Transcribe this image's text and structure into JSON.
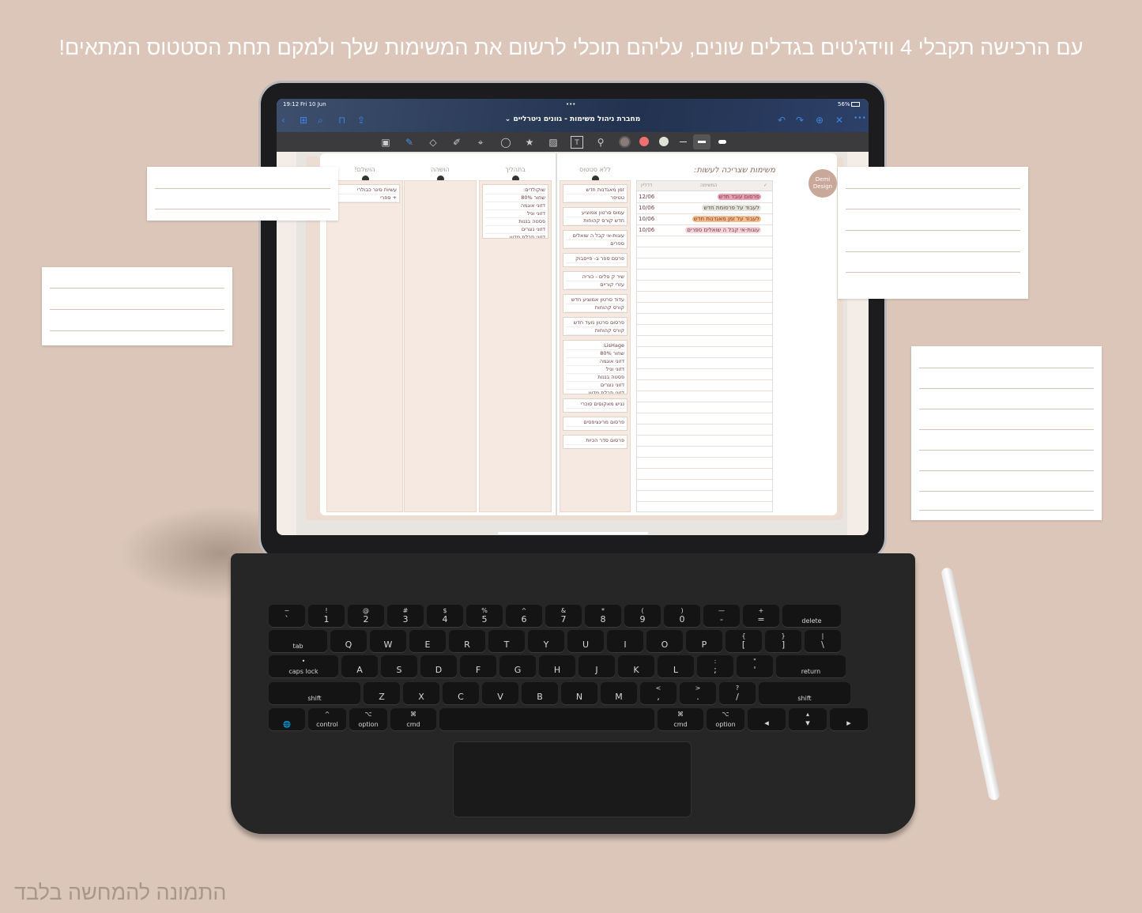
{
  "headline": "עם הרכישה תקבלי 4 ווידג'טים בגדלים שונים, עליהם תוכלי לרשום את המשימות שלך ולמקם תחת הסטטוס המתאים!",
  "disclaimer": "התמונה להמחשה בלבד",
  "status_bar": {
    "time": "19:12",
    "date": "Fri 10 Jun",
    "battery": "56%",
    "dots": "•••"
  },
  "app": {
    "title": "מחברת ניהול משימות - גוונים ניטרליים",
    "title_chevron": "⌄",
    "nav_left": [
      "‹",
      "⊞",
      "⌕",
      "⊓",
      "⇪"
    ],
    "nav_right": [
      "↶",
      "↷",
      "⊕",
      "✕",
      "•••"
    ],
    "tools": [
      "▣",
      "✎",
      "◇",
      "✐",
      "⌖",
      "◯",
      "★",
      "▨",
      "T",
      "⚲"
    ],
    "colors": [
      "#8a7a78",
      "#f07070",
      "#dfe3d6"
    ]
  },
  "planner": {
    "title": "משימות שצריכה לעשות:",
    "logo": "Demi Design",
    "columns": [
      {
        "header": "הושלם!",
        "cards": [
          [
            "עשיות סיגר כבולרי",
            "+ ספרי"
          ]
        ]
      },
      {
        "header": "הושהה",
        "cards": []
      },
      {
        "header": "בתהליך",
        "cards": [
          [
            "שוקולדים:",
            "שחור 80%",
            "דזוני אוגמה",
            "דזוני וניל",
            "פסטה בננות",
            "דזוני נוגרים",
            "דזוני תבלת מדוע"
          ]
        ]
      },
      {
        "header": "ללא סטטוס",
        "cards": [
          [
            "זמן מאגדנות חדש",
            "טטיפר"
          ],
          [
            "עמוס סרטון אמוציע",
            "חדש קורס קהוחות"
          ],
          [
            "עוגות-אי קבל ה שואלים",
            "ספרים"
          ],
          [
            "פרסם ספר ב- פייסבוק"
          ],
          [
            "שיר ק סלים - כוריה",
            "עזרי קוריים"
          ],
          [
            "עדוד סרטון אמוציע חדש",
            "קורס קהוחות"
          ],
          [
            "פרסום סרטון מעד חדש",
            "קורס קהוחות"
          ],
          [
            "LisHage:",
            "שחור 80%",
            "דזוני אוגמה",
            "דזוני וניל",
            "פסטה בננות",
            "דזוני נוגרים",
            "דזוני תבלת מדוע"
          ],
          [
            "נגיש מאקוסים סוכרי"
          ],
          [
            "פרסום מרינציפסים"
          ],
          [
            "פרסום סדר הכיות"
          ]
        ]
      }
    ],
    "table": {
      "check_header": "✓",
      "task_header": "המשימה",
      "deadline_header": "דדליין",
      "rows": [
        {
          "task": "פרסום עובד חדש",
          "deadline": "12/06",
          "color": "#e9a0b0"
        },
        {
          "task": "לעבוד על פרסומת חדש",
          "deadline": "10/06",
          "color": "#dfe6da"
        },
        {
          "task": "לעבוד על זמן מאגדנות חדש",
          "deadline": "10/06",
          "color": "#f4bd8a"
        },
        {
          "task": "עוגות-אי קבל ה שואלים ספרים",
          "deadline": "10/06",
          "color": "#f7d2da"
        }
      ]
    }
  },
  "keyboard": {
    "rows": [
      [
        [
          "~",
          "`"
        ],
        [
          "!",
          "1"
        ],
        [
          "@",
          "2"
        ],
        [
          "#",
          "3"
        ],
        [
          "$",
          "4"
        ],
        [
          "%",
          "5"
        ],
        [
          "^",
          "6"
        ],
        [
          "&",
          "7"
        ],
        [
          "*",
          "8"
        ],
        [
          "(",
          "9"
        ],
        [
          ")",
          "0"
        ],
        [
          "—",
          "-"
        ],
        [
          "+",
          "="
        ],
        [
          "",
          "delete"
        ]
      ],
      [
        [
          "",
          "tab"
        ],
        [
          "",
          "Q"
        ],
        [
          "",
          "W"
        ],
        [
          "",
          "E"
        ],
        [
          "",
          "R"
        ],
        [
          "",
          "T"
        ],
        [
          "",
          "Y"
        ],
        [
          "",
          "U"
        ],
        [
          "",
          "I"
        ],
        [
          "",
          "O"
        ],
        [
          "",
          "P"
        ],
        [
          "{",
          "["
        ],
        [
          "}",
          "]"
        ],
        [
          "|",
          "\\"
        ]
      ],
      [
        [
          "•",
          "caps lock"
        ],
        [
          "",
          "A"
        ],
        [
          "",
          "S"
        ],
        [
          "",
          "D"
        ],
        [
          "",
          "F"
        ],
        [
          "",
          "G"
        ],
        [
          "",
          "H"
        ],
        [
          "",
          "J"
        ],
        [
          "",
          "K"
        ],
        [
          "",
          "L"
        ],
        [
          ":",
          ";"
        ],
        [
          "\"",
          "'"
        ],
        [
          "",
          "return"
        ]
      ],
      [
        [
          "",
          "shift"
        ],
        [
          "",
          "Z"
        ],
        [
          "",
          "X"
        ],
        [
          "",
          "C"
        ],
        [
          "",
          "V"
        ],
        [
          "",
          "B"
        ],
        [
          "",
          "N"
        ],
        [
          "",
          "M"
        ],
        [
          "<",
          ","
        ],
        [
          ">",
          "."
        ],
        [
          "?",
          "/"
        ],
        [
          "",
          "shift"
        ]
      ],
      [
        [
          "",
          "🌐"
        ],
        [
          "^",
          "control"
        ],
        [
          "⌥",
          "option"
        ],
        [
          "⌘",
          "cmd"
        ],
        [
          "",
          ""
        ],
        [
          "⌘",
          "cmd"
        ],
        [
          "⌥",
          "option"
        ],
        [
          "",
          "◂"
        ],
        [
          "▴",
          "▾"
        ],
        [
          "",
          "▸"
        ]
      ]
    ]
  }
}
